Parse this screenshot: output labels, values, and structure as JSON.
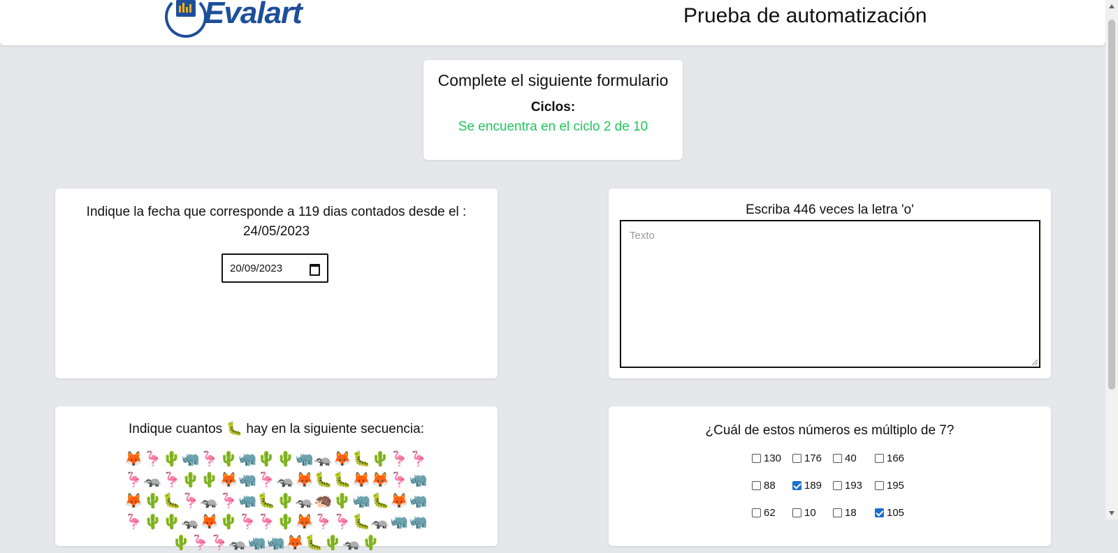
{
  "header": {
    "logo_text": "Evalart",
    "title": "Prueba de automatización"
  },
  "status": {
    "title": "Complete el siguiente formulario",
    "cycles_label": "Ciclos:",
    "cycles_text": "Se encuentra en el ciclo 2 de 10"
  },
  "date_question": {
    "text": "Indique la fecha que corresponde a 119 dias contados desde el : 24/05/2023",
    "value": "20/09/2023"
  },
  "text_question": {
    "text": "Escriba 446 veces la letra 'o'",
    "placeholder": "Texto"
  },
  "sequence_question": {
    "prefix": "Indique cuantos ",
    "target_emoji": "🐛",
    "suffix": " hay en la siguiente secuencia:",
    "sequence": "🦊🦩🌵🦏🦩🌵🦏🌵🌵🦏🦡🦊🐛🌵🦩🦩🦩🦡🦩🌵🌵🦊🦏🦩🦡🦊🐛🐛🦊🦊🦩🦏🦊🌵🐛🦩🦡🦩🦏🐛🌵🦡🦔🌵🦏🐛🦊🦏🦩🌵🌵🦡🦊🌵🦩🦩🌵🦊🦩🦩🐛🦡🦏🦏🌵🦩🦩🦡🦏🦏🦊🐛🌵🦡🌵"
  },
  "multiple_question": {
    "text": "¿Cuál de estos números es múltiplo de 7?",
    "options": [
      {
        "label": "130",
        "checked": false
      },
      {
        "label": "176",
        "checked": false
      },
      {
        "label": "40",
        "checked": false
      },
      {
        "label": "166",
        "checked": false
      },
      {
        "label": "88",
        "checked": false
      },
      {
        "label": "189",
        "checked": true
      },
      {
        "label": "193",
        "checked": false
      },
      {
        "label": "195",
        "checked": false
      },
      {
        "label": "62",
        "checked": false
      },
      {
        "label": "10",
        "checked": false
      },
      {
        "label": "18",
        "checked": false
      },
      {
        "label": "105",
        "checked": true
      }
    ]
  }
}
